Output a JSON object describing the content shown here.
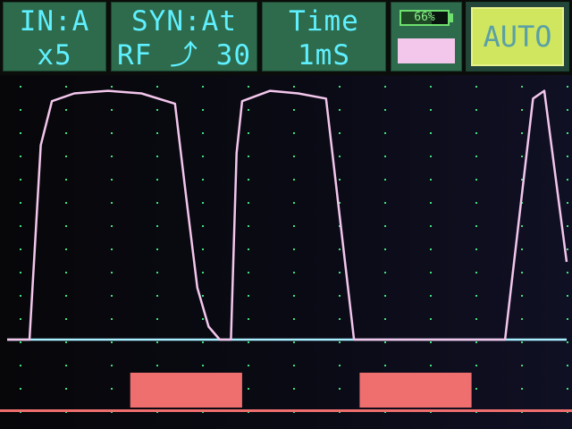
{
  "header": {
    "input": {
      "channel": "IN:A",
      "gain": "x5"
    },
    "sync": {
      "mode": "SYN:At",
      "trigger": "RF ⤴ 30"
    },
    "time": {
      "label": "Time",
      "value": "1mS"
    },
    "battery": {
      "percent": "66%",
      "level": 0.66,
      "channel_color": "#f3c6ec"
    },
    "auto_label": "AUTO"
  },
  "colors": {
    "panel_bg": "#2e6a4c",
    "panel_text": "#5ff0ff",
    "trace": "#f3c6ec",
    "baseline": "#a8f0ff",
    "grid_dot": "#3fe07a",
    "marker": "#ef6f6f",
    "auto_bg": "#cfe65e"
  },
  "icons": {
    "battery": "battery-icon",
    "trigger_edge": "rising-edge-icon"
  },
  "chart_data": {
    "type": "line",
    "series": [
      {
        "values_description_free": true,
        "x": [
          0,
          4,
          6,
          8,
          12,
          18,
          24,
          30,
          32,
          34,
          36,
          38,
          40,
          41,
          42,
          47,
          52,
          57,
          62,
          66,
          72,
          78,
          84,
          89,
          94,
          96,
          100
        ],
        "y": [
          0.0,
          0.0,
          0.75,
          0.92,
          0.95,
          0.96,
          0.95,
          0.91,
          0.55,
          0.2,
          0.05,
          0.0,
          0.0,
          0.72,
          0.92,
          0.96,
          0.95,
          0.93,
          0.0,
          0.0,
          0.0,
          0.0,
          0.0,
          0.0,
          0.93,
          0.96,
          0.3
        ]
      }
    ],
    "markers": [
      {
        "start": 22,
        "end": 42
      },
      {
        "start": 63,
        "end": 83
      }
    ]
  }
}
